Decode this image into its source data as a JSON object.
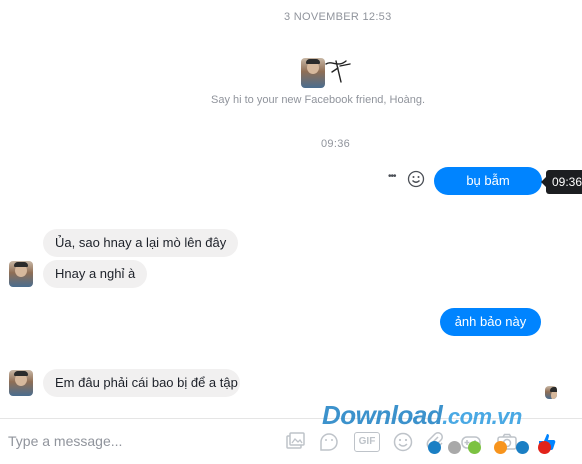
{
  "header": {
    "date_stamp": "3 NOVEMBER 12:53"
  },
  "intro": {
    "caption": "Say hi to your new Facebook friend, Hoàng."
  },
  "time_divider": "09:36",
  "messages": {
    "out1": "bụ bẫm",
    "in1": "Ủa, sao hnay a lại mò lên đây",
    "in2": "Hnay a nghỉ à",
    "out2": "ảnh bảo này",
    "in3": "Em đâu phải cái bao bị để a tập"
  },
  "tooltip": {
    "time": "09:36"
  },
  "message_actions": {
    "more": "•••"
  },
  "composer": {
    "placeholder": "Type a message..."
  },
  "toolbar": {
    "gif_label": "GIF"
  },
  "watermark": {
    "text": "Download",
    "domain": ".com.vn"
  },
  "colors": {
    "accent": "#0084ff",
    "incoming_bubble": "#f1f0f0",
    "watermark_dots": [
      "#1b7fc4",
      "#a9a9a9",
      "#7cc242",
      "#f7941d",
      "#1b7fc4",
      "#e2231a"
    ]
  }
}
